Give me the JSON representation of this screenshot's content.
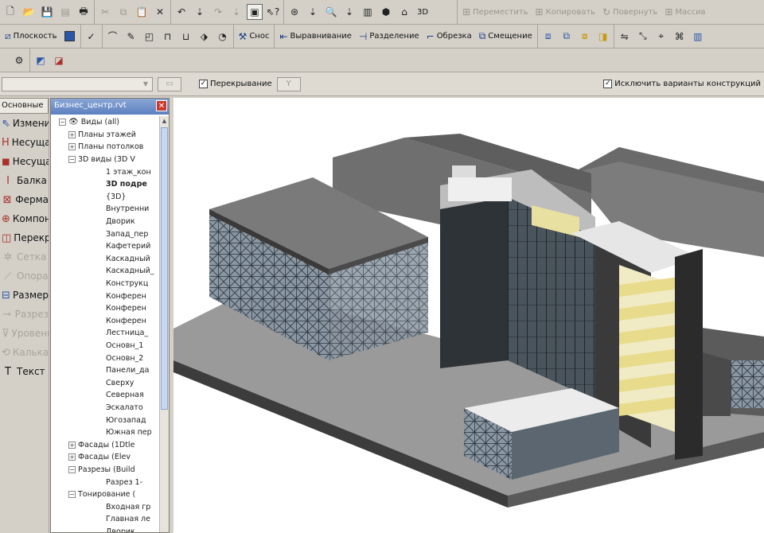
{
  "toolbar_top": {
    "mode_3d_label": "3D",
    "right_buttons": [
      "Переместить",
      "Копировать",
      "Повернуть",
      "Массив"
    ]
  },
  "toolbar_edit": {
    "plane_label": "Плоскость",
    "demolish_label": "Снос",
    "align_label": "Выравнивание",
    "split_label": "Разделение",
    "trim_label": "Обрезка",
    "offset_label": "Смещение"
  },
  "options_bar": {
    "level_select_value": "",
    "overlay_label": "Перекрывание",
    "overlay_checked": true,
    "exclude_options_label": "Исключить варианты конструкций",
    "exclude_options_checked": true
  },
  "design_bar": {
    "tab_label": "Основные",
    "items": [
      {
        "label": "Изменить",
        "icon": "pointer-icon",
        "enabled": true
      },
      {
        "label": "Несущая стена",
        "icon": "wall-icon",
        "enabled": true
      },
      {
        "label": "Несущая колонна",
        "icon": "column-icon",
        "enabled": true
      },
      {
        "label": "Балка",
        "icon": "beam-icon",
        "enabled": true
      },
      {
        "label": "Ферма",
        "icon": "truss-icon",
        "enabled": true
      },
      {
        "label": "Компонент",
        "icon": "component-icon",
        "enabled": true
      },
      {
        "label": "Перекрытие",
        "icon": "slab-icon",
        "enabled": true
      },
      {
        "label": "Сетка",
        "icon": "grid-icon",
        "enabled": false
      },
      {
        "label": "Опора",
        "icon": "support-icon",
        "enabled": false
      },
      {
        "label": "Размер",
        "icon": "dimension-icon",
        "enabled": true
      },
      {
        "label": "Разрез",
        "icon": "section-icon",
        "enabled": false
      },
      {
        "label": "Уровень",
        "icon": "level-icon",
        "enabled": false
      },
      {
        "label": "Калька",
        "icon": "tracing-icon",
        "enabled": false
      },
      {
        "label": "Текст",
        "icon": "text-icon",
        "enabled": true
      }
    ]
  },
  "project_browser": {
    "title": "Бизнес_центр.rvt",
    "nodes": [
      {
        "text": "Виды (all)",
        "level": 0,
        "toggle": "−",
        "eye": true
      },
      {
        "text": "Планы этажей",
        "level": 1,
        "toggle": "+"
      },
      {
        "text": "Планы потолков",
        "level": 1,
        "toggle": "+"
      },
      {
        "text": "3D виды (3D V",
        "level": 1,
        "toggle": "−"
      },
      {
        "text": "1 этаж_кон",
        "level": 2
      },
      {
        "text": "3D подре",
        "level": 2,
        "bold": true
      },
      {
        "text": "{3D}",
        "level": 2
      },
      {
        "text": "Внутренни",
        "level": 2
      },
      {
        "text": "Дворик",
        "level": 2
      },
      {
        "text": "Запад_пер",
        "level": 2
      },
      {
        "text": "Кафетерий",
        "level": 2
      },
      {
        "text": "Каскадный",
        "level": 2
      },
      {
        "text": "Каскадный_",
        "level": 2
      },
      {
        "text": "Конструкц",
        "level": 2
      },
      {
        "text": "Конферен",
        "level": 2
      },
      {
        "text": "Конферен",
        "level": 2
      },
      {
        "text": "Конферен",
        "level": 2
      },
      {
        "text": "Лестница_",
        "level": 2
      },
      {
        "text": "Основн_1",
        "level": 2
      },
      {
        "text": "Основн_2",
        "level": 2
      },
      {
        "text": "Панели_да",
        "level": 2
      },
      {
        "text": "Сверху",
        "level": 2
      },
      {
        "text": "Северная",
        "level": 2
      },
      {
        "text": "Эскалато",
        "level": 2
      },
      {
        "text": "Югозапад",
        "level": 2
      },
      {
        "text": "Южная пер",
        "level": 2
      },
      {
        "text": "Фасады (1Dtle",
        "level": 1,
        "toggle": "+"
      },
      {
        "text": "Фасады (Elev",
        "level": 1,
        "toggle": "+"
      },
      {
        "text": "Разрезы (Build",
        "level": 1,
        "toggle": "−"
      },
      {
        "text": "Разрез 1-",
        "level": 2
      },
      {
        "text": "Тонирование (",
        "level": 1,
        "toggle": "−"
      },
      {
        "text": "Входная гр",
        "level": 2
      },
      {
        "text": "Главная ле",
        "level": 2
      },
      {
        "text": "Дворик",
        "level": 2
      }
    ]
  },
  "colors": {
    "toolbar_bg": "#d4d0c8",
    "browser_title": "#5c7fbf",
    "canvas_bg": "#ffffff",
    "slab_yellow": "#e8e0a0"
  }
}
